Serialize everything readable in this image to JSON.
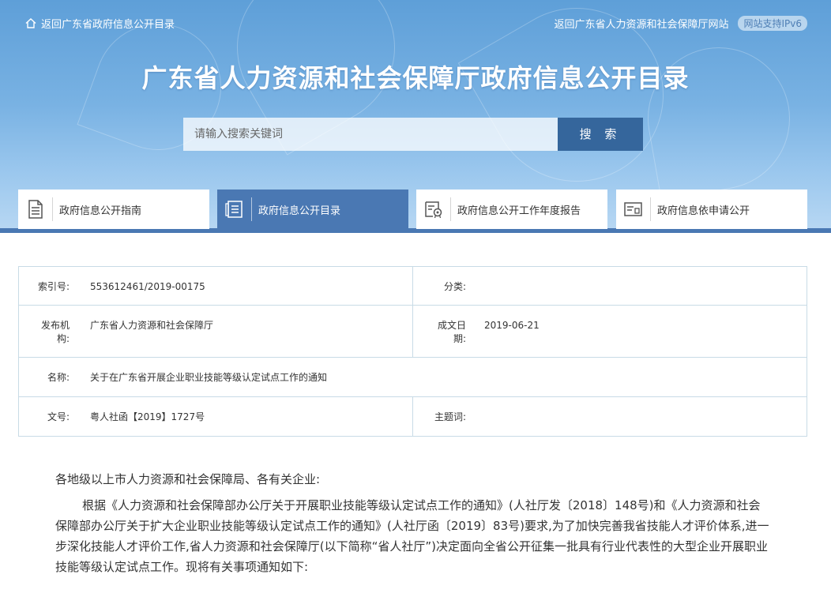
{
  "header": {
    "back_link": "返回广东省政府信息公开目录",
    "dept_link": "返回广东省人力资源和社会保障厅网站",
    "ipv6_badge": "网站支持IPv6",
    "title": "广东省人力资源和社会保障厅政府信息公开目录"
  },
  "search": {
    "placeholder": "请输入搜索关键词",
    "button_label": "搜 索"
  },
  "tabs": [
    {
      "label": "政府信息公开指南",
      "icon": "document-list-icon",
      "active": false
    },
    {
      "label": "政府信息公开目录",
      "icon": "catalog-icon",
      "active": true
    },
    {
      "label": "政府信息公开工作年度报告",
      "icon": "report-certificate-icon",
      "active": false
    },
    {
      "label": "政府信息依申请公开",
      "icon": "application-form-icon",
      "active": false
    }
  ],
  "meta": {
    "index_label": "索引号:",
    "index_value": "553612461/2019-00175",
    "category_label": "分类:",
    "category_value": "",
    "publisher_label_1": "发布机",
    "publisher_label_2": "构:",
    "publisher_value": "广东省人力资源和社会保障厅",
    "date_label_1": "成文日",
    "date_label_2": "期:",
    "date_value": "2019-06-21",
    "name_label": "名称:",
    "name_value": "关于在广东省开展企业职业技能等级认定试点工作的通知",
    "doc_no_label": "文号:",
    "doc_no_value": "粤人社函【2019】1727号",
    "subject_label": "主题词:",
    "subject_value": ""
  },
  "content": {
    "greeting": "各地级以上市人力资源和社会保障局、各有关企业:",
    "paragraph": "根据《人力资源和社会保障部办公厅关于开展职业技能等级认定试点工作的通知》(人社厅发〔2018〕148号)和《人力资源和社会保障部办公厅关于扩大企业职业技能等级认定试点工作的通知》(人社厅函〔2019〕83号)要求,为了加快完善我省技能人才评价体系,进一步深化技能人才评价工作,省人力资源和社会保障厅(以下简称“省人社厅”)决定面向全省公开征集一批具有行业代表性的大型企业开展职业技能等级认定试点工作。现将有关事项通知如下:"
  }
}
